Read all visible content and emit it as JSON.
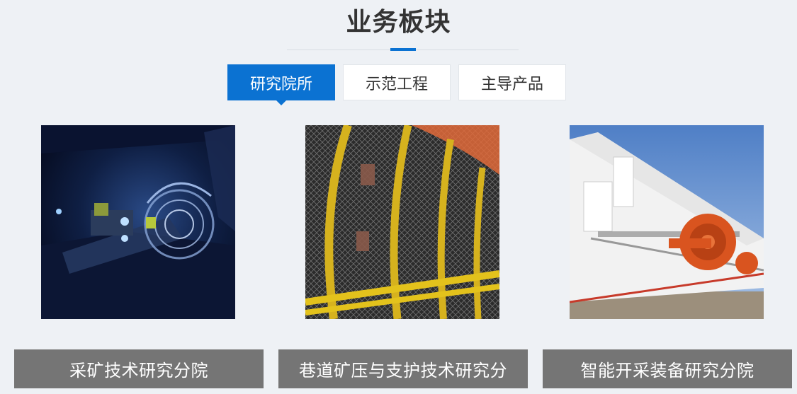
{
  "section": {
    "title": "业务板块"
  },
  "tabs": [
    {
      "label": "研究院所",
      "active": true
    },
    {
      "label": "示范工程",
      "active": false
    },
    {
      "label": "主导产品",
      "active": false
    }
  ],
  "cards": [
    {
      "caption": "采矿技术研究分院",
      "image": "underground-mining-machine-photo"
    },
    {
      "caption": "巷道矿压与支护技术研究分",
      "image": "tunnel-support-arches-photo"
    },
    {
      "caption": "智能开采装备研究分院",
      "image": "bucket-wheel-excavator-photo"
    }
  ],
  "colors": {
    "accent": "#0b72d2",
    "caption_bg": "#757575",
    "page_bg": "#eef1f5"
  }
}
